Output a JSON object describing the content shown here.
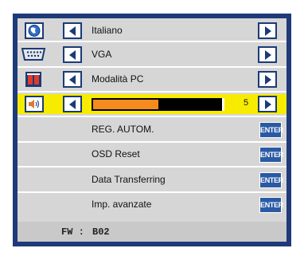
{
  "menu": {
    "rows": [
      {
        "icon": "globe-language-icon",
        "label": "Italiano"
      },
      {
        "icon": "vga-connector-icon",
        "label": "VGA"
      },
      {
        "icon": "display-mode-icon",
        "label": "Modalità PC"
      },
      {
        "icon": "volume-speaker-icon",
        "slider_fraction": 0.5,
        "value": "5"
      }
    ],
    "actions": [
      {
        "label": "REG. AUTOM.",
        "button": "ENTER"
      },
      {
        "label": "OSD Reset",
        "button": "ENTER"
      },
      {
        "label": "Data Transferring",
        "button": "ENTER"
      },
      {
        "label": "Imp. avanzate",
        "button": "ENTER"
      }
    ]
  },
  "footer": {
    "fw_label": "FW :",
    "fw_value": "B02"
  },
  "colors": {
    "frame": "#1e3a78",
    "selected_row": "#f7ec00",
    "slider_fill": "#f58a1f",
    "enter_button": "#2a5aa4"
  }
}
